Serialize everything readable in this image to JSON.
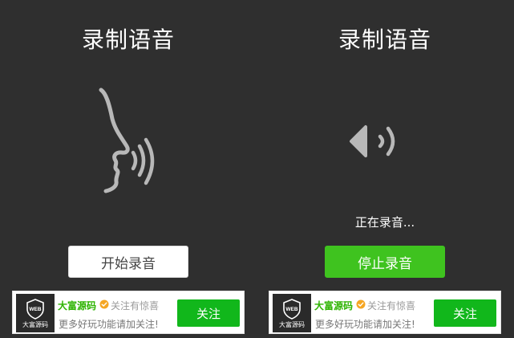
{
  "left_panel": {
    "title": "录制语音",
    "icon": "face-speaking-icon",
    "button_label": "开始录音"
  },
  "right_panel": {
    "title": "录制语音",
    "icon": "speaker-sound-icon",
    "status_text": "正在录音...",
    "button_label": "停止录音"
  },
  "ad": {
    "logo_icon": "web-shield-icon",
    "logo_text": "大富源码",
    "name": "大富源码",
    "verified_icon": "verified-check-icon",
    "follow_hint": "关注有惊喜",
    "description": "更多好玩功能请加关注!",
    "button_label": "关注"
  },
  "colors": {
    "background": "#2f2f2f",
    "stop_button": "#3fc31f",
    "ad_button": "#11b71b",
    "ad_name": "#2db300"
  }
}
